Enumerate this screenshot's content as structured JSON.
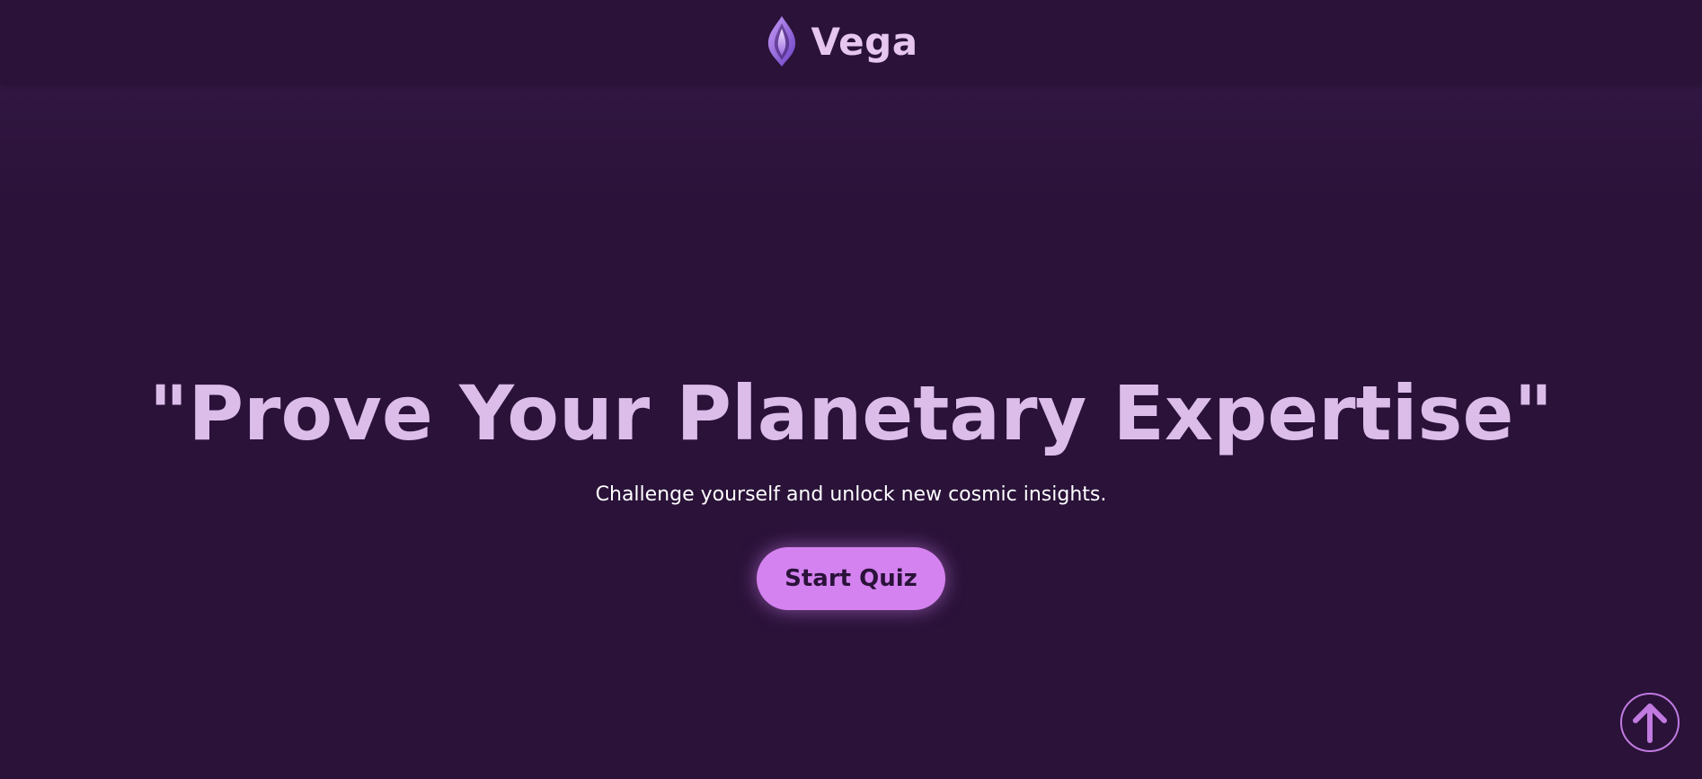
{
  "header": {
    "brand_name": "Vega",
    "logo_icon": "flame-crystal-icon"
  },
  "hero": {
    "title": "\"Prove Your Planetary Expertise\"",
    "subtitle": "Challenge yourself and unlock new cosmic insights.",
    "cta_label": "Start Quiz"
  },
  "scroll_top": {
    "icon": "arrow-up-icon"
  },
  "colors": {
    "background": "#2a1239",
    "title": "#dcbdea",
    "brand": "#e6c6ef",
    "accent": "#d482f0",
    "button_text": "#2a1239"
  }
}
